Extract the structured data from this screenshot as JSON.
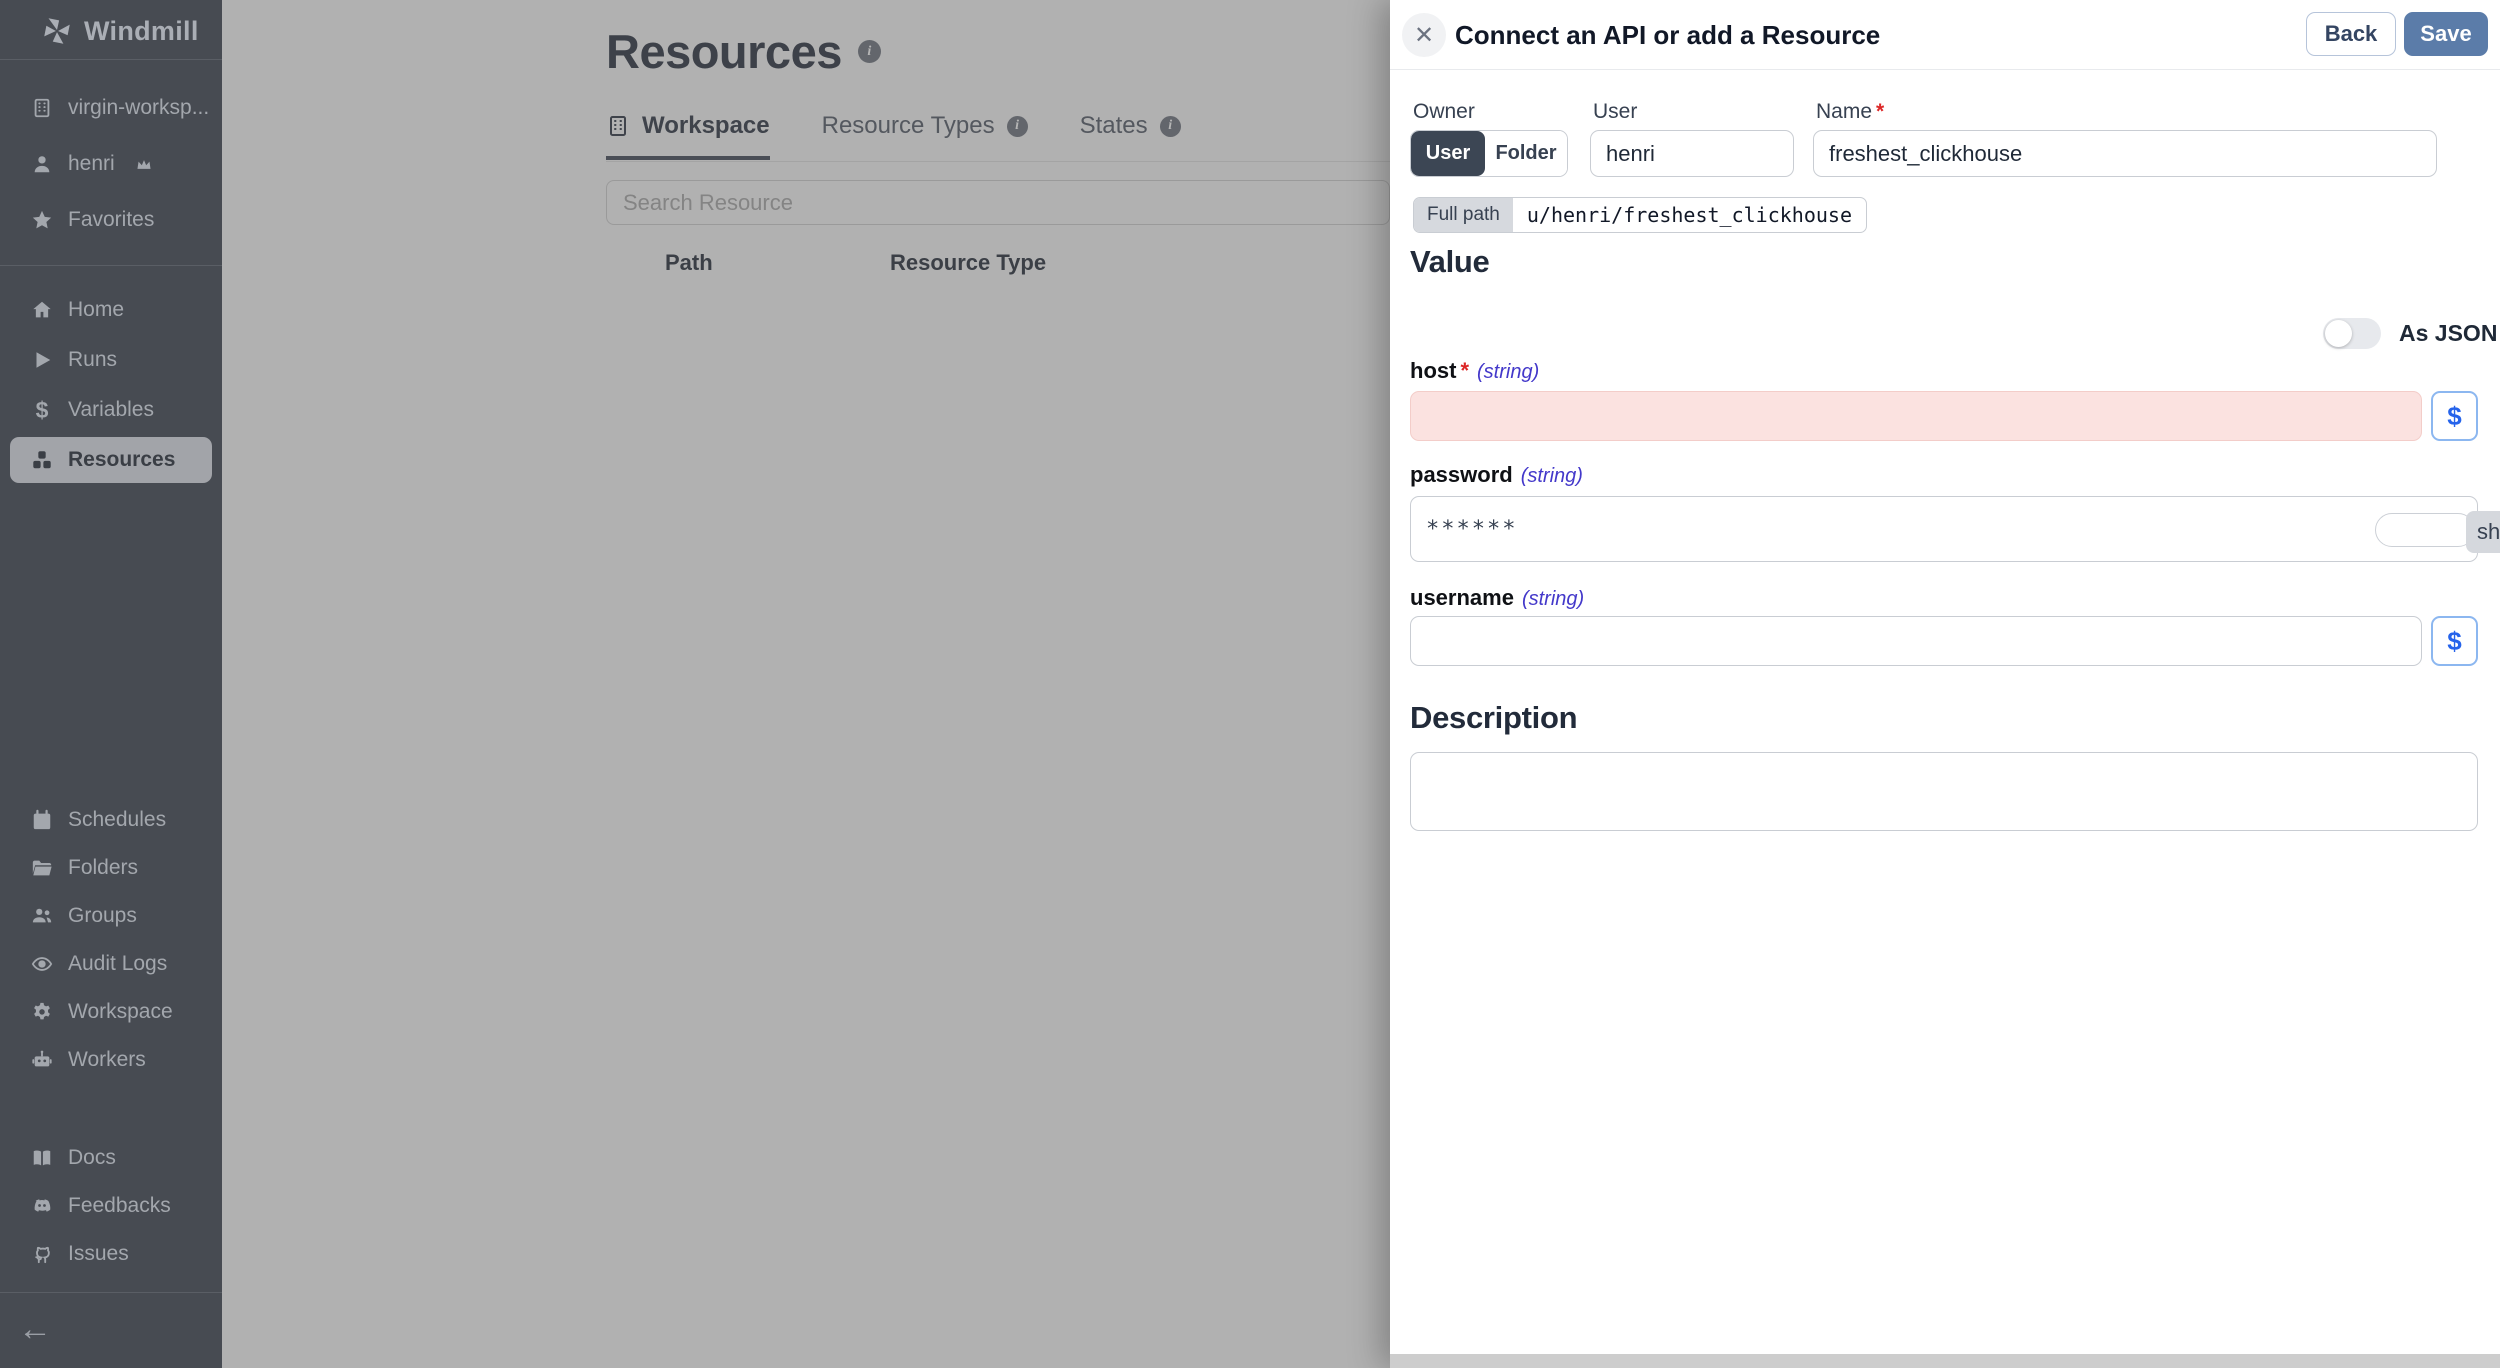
{
  "sidebar": {
    "brand": "Windmill",
    "workspace_label": "virgin-worksp...",
    "user_label": "henri",
    "favorites_label": "Favorites",
    "nav": [
      {
        "label": "Home"
      },
      {
        "label": "Runs"
      },
      {
        "label": "Variables"
      },
      {
        "label": "Resources",
        "active": true
      }
    ],
    "admin_nav": [
      {
        "label": "Schedules"
      },
      {
        "label": "Folders"
      },
      {
        "label": "Groups"
      },
      {
        "label": "Audit Logs"
      },
      {
        "label": "Workspace"
      },
      {
        "label": "Workers"
      }
    ],
    "footer_nav": [
      {
        "label": "Docs"
      },
      {
        "label": "Feedbacks"
      },
      {
        "label": "Issues"
      }
    ],
    "collapse_arrow": "←"
  },
  "main": {
    "title": "Resources",
    "tabs": [
      {
        "label": "Workspace",
        "active": true
      },
      {
        "label": "Resource Types"
      },
      {
        "label": "States"
      }
    ],
    "search_placeholder": "Search Resource",
    "table_headers": {
      "path": "Path",
      "resource_type": "Resource Type"
    }
  },
  "drawer": {
    "title": "Connect an API or add a Resource",
    "back_label": "Back",
    "save_label": "Save",
    "close_glyph": "✕",
    "owner_label": "Owner",
    "owner_option_user": "User",
    "owner_option_folder": "Folder",
    "user_label": "User",
    "user_value": "henri",
    "name_label": "Name",
    "required_mark": "*",
    "name_value": "freshest_clickhouse",
    "full_path_label": "Full path",
    "full_path_value": "u/henri/freshest_clickhouse",
    "value_heading": "Value",
    "as_json_label": "As JSON",
    "fields": {
      "host": {
        "name": "host",
        "required": "*",
        "type": "(string)",
        "dollar": "$"
      },
      "password": {
        "name": "password",
        "type": "(string)",
        "value": "******",
        "show_label": "sh"
      },
      "username": {
        "name": "username",
        "type": "(string)",
        "dollar": "$"
      }
    },
    "description_heading": "Description"
  },
  "colors": {
    "save_accent": "#5b7ca9",
    "invalid_field_bg": "#fbe2e0",
    "type_hint": "#4338ca",
    "required": "#dc2626",
    "sidebar_bg": "#474b52"
  }
}
